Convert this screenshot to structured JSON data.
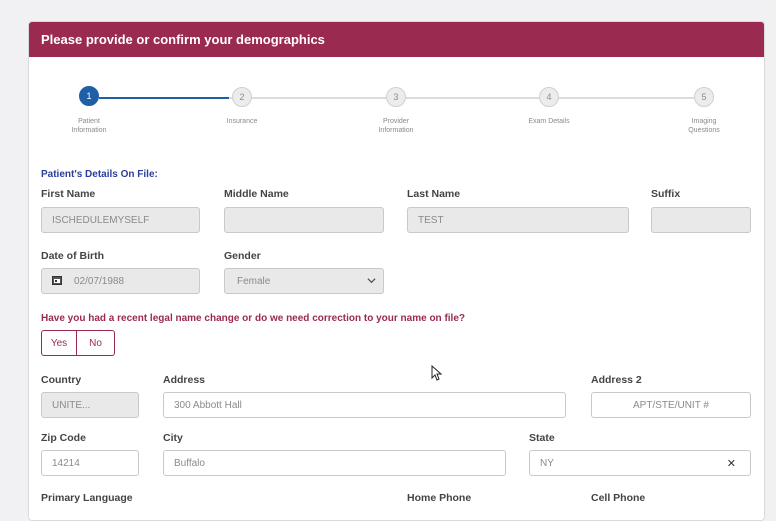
{
  "header": {
    "title": "Please provide or confirm your demographics"
  },
  "stepper": {
    "steps": [
      {
        "number": "1",
        "label_line1": "Patient",
        "label_line2": "Information"
      },
      {
        "number": "2",
        "label_line1": "Insurance",
        "label_line2": ""
      },
      {
        "number": "3",
        "label_line1": "Provider",
        "label_line2": "Information"
      },
      {
        "number": "4",
        "label_line1": "Exam Details",
        "label_line2": ""
      },
      {
        "number": "5",
        "label_line1": "Imaging",
        "label_line2": "Questions"
      }
    ],
    "active_step": 1
  },
  "section_title": "Patient's Details On File:",
  "labels": {
    "first_name": "First Name",
    "middle_name": "Middle Name",
    "last_name": "Last Name",
    "suffix": "Suffix",
    "dob": "Date of Birth",
    "gender": "Gender",
    "country": "Country",
    "address": "Address",
    "address2": "Address 2",
    "zip": "Zip Code",
    "city": "City",
    "state": "State",
    "primary_language": "Primary Language",
    "home_phone": "Home Phone",
    "cell_phone": "Cell Phone"
  },
  "values": {
    "first_name": "ISCHEDULEMYSELF",
    "middle_name": "",
    "last_name": "TEST",
    "suffix": "",
    "dob": "02/07/1988",
    "gender": "Female",
    "country": "UNITE...",
    "address": "300 Abbott Hall",
    "zip": "14214",
    "city": "Buffalo",
    "state": "NY"
  },
  "placeholders": {
    "address2": "APT/STE/UNIT #"
  },
  "question": {
    "text": "Have you had a recent legal name change or do we need correction to your name on file?",
    "yes_label": "Yes",
    "no_label": "No"
  },
  "icons": {
    "calendar": "calendar-icon",
    "dropdown": "chevron-down-icon",
    "clear": "close-icon",
    "cursor": "mouse-pointer-icon"
  },
  "colors": {
    "brand": "#9b2a50",
    "active_step": "#1e5fa8",
    "section_title": "#2a3f9c"
  }
}
